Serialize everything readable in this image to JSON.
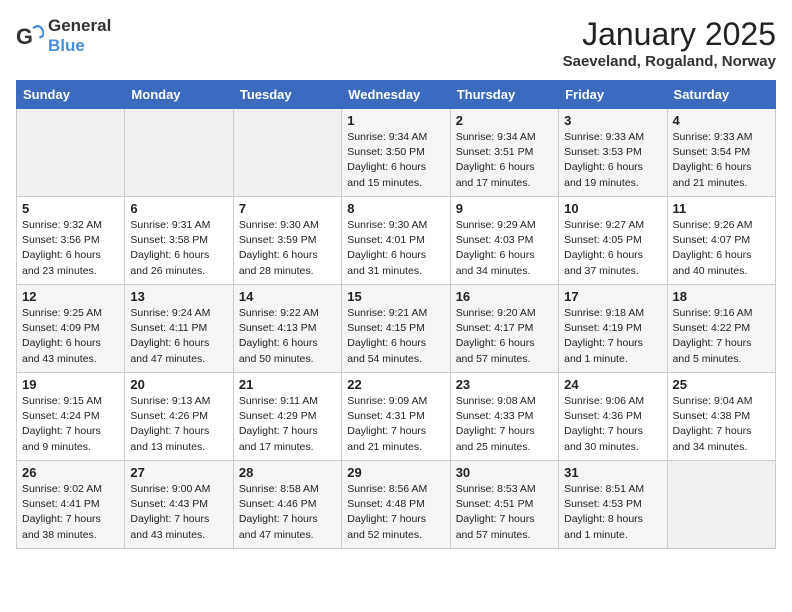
{
  "logo": {
    "general": "General",
    "blue": "Blue"
  },
  "title": "January 2025",
  "location": "Saeveland, Rogaland, Norway",
  "weekdays": [
    "Sunday",
    "Monday",
    "Tuesday",
    "Wednesday",
    "Thursday",
    "Friday",
    "Saturday"
  ],
  "weeks": [
    [
      {
        "day": "",
        "info": ""
      },
      {
        "day": "",
        "info": ""
      },
      {
        "day": "",
        "info": ""
      },
      {
        "day": "1",
        "info": "Sunrise: 9:34 AM\nSunset: 3:50 PM\nDaylight: 6 hours\nand 15 minutes."
      },
      {
        "day": "2",
        "info": "Sunrise: 9:34 AM\nSunset: 3:51 PM\nDaylight: 6 hours\nand 17 minutes."
      },
      {
        "day": "3",
        "info": "Sunrise: 9:33 AM\nSunset: 3:53 PM\nDaylight: 6 hours\nand 19 minutes."
      },
      {
        "day": "4",
        "info": "Sunrise: 9:33 AM\nSunset: 3:54 PM\nDaylight: 6 hours\nand 21 minutes."
      }
    ],
    [
      {
        "day": "5",
        "info": "Sunrise: 9:32 AM\nSunset: 3:56 PM\nDaylight: 6 hours\nand 23 minutes."
      },
      {
        "day": "6",
        "info": "Sunrise: 9:31 AM\nSunset: 3:58 PM\nDaylight: 6 hours\nand 26 minutes."
      },
      {
        "day": "7",
        "info": "Sunrise: 9:30 AM\nSunset: 3:59 PM\nDaylight: 6 hours\nand 28 minutes."
      },
      {
        "day": "8",
        "info": "Sunrise: 9:30 AM\nSunset: 4:01 PM\nDaylight: 6 hours\nand 31 minutes."
      },
      {
        "day": "9",
        "info": "Sunrise: 9:29 AM\nSunset: 4:03 PM\nDaylight: 6 hours\nand 34 minutes."
      },
      {
        "day": "10",
        "info": "Sunrise: 9:27 AM\nSunset: 4:05 PM\nDaylight: 6 hours\nand 37 minutes."
      },
      {
        "day": "11",
        "info": "Sunrise: 9:26 AM\nSunset: 4:07 PM\nDaylight: 6 hours\nand 40 minutes."
      }
    ],
    [
      {
        "day": "12",
        "info": "Sunrise: 9:25 AM\nSunset: 4:09 PM\nDaylight: 6 hours\nand 43 minutes."
      },
      {
        "day": "13",
        "info": "Sunrise: 9:24 AM\nSunset: 4:11 PM\nDaylight: 6 hours\nand 47 minutes."
      },
      {
        "day": "14",
        "info": "Sunrise: 9:22 AM\nSunset: 4:13 PM\nDaylight: 6 hours\nand 50 minutes."
      },
      {
        "day": "15",
        "info": "Sunrise: 9:21 AM\nSunset: 4:15 PM\nDaylight: 6 hours\nand 54 minutes."
      },
      {
        "day": "16",
        "info": "Sunrise: 9:20 AM\nSunset: 4:17 PM\nDaylight: 6 hours\nand 57 minutes."
      },
      {
        "day": "17",
        "info": "Sunrise: 9:18 AM\nSunset: 4:19 PM\nDaylight: 7 hours\nand 1 minute."
      },
      {
        "day": "18",
        "info": "Sunrise: 9:16 AM\nSunset: 4:22 PM\nDaylight: 7 hours\nand 5 minutes."
      }
    ],
    [
      {
        "day": "19",
        "info": "Sunrise: 9:15 AM\nSunset: 4:24 PM\nDaylight: 7 hours\nand 9 minutes."
      },
      {
        "day": "20",
        "info": "Sunrise: 9:13 AM\nSunset: 4:26 PM\nDaylight: 7 hours\nand 13 minutes."
      },
      {
        "day": "21",
        "info": "Sunrise: 9:11 AM\nSunset: 4:29 PM\nDaylight: 7 hours\nand 17 minutes."
      },
      {
        "day": "22",
        "info": "Sunrise: 9:09 AM\nSunset: 4:31 PM\nDaylight: 7 hours\nand 21 minutes."
      },
      {
        "day": "23",
        "info": "Sunrise: 9:08 AM\nSunset: 4:33 PM\nDaylight: 7 hours\nand 25 minutes."
      },
      {
        "day": "24",
        "info": "Sunrise: 9:06 AM\nSunset: 4:36 PM\nDaylight: 7 hours\nand 30 minutes."
      },
      {
        "day": "25",
        "info": "Sunrise: 9:04 AM\nSunset: 4:38 PM\nDaylight: 7 hours\nand 34 minutes."
      }
    ],
    [
      {
        "day": "26",
        "info": "Sunrise: 9:02 AM\nSunset: 4:41 PM\nDaylight: 7 hours\nand 38 minutes."
      },
      {
        "day": "27",
        "info": "Sunrise: 9:00 AM\nSunset: 4:43 PM\nDaylight: 7 hours\nand 43 minutes."
      },
      {
        "day": "28",
        "info": "Sunrise: 8:58 AM\nSunset: 4:46 PM\nDaylight: 7 hours\nand 47 minutes."
      },
      {
        "day": "29",
        "info": "Sunrise: 8:56 AM\nSunset: 4:48 PM\nDaylight: 7 hours\nand 52 minutes."
      },
      {
        "day": "30",
        "info": "Sunrise: 8:53 AM\nSunset: 4:51 PM\nDaylight: 7 hours\nand 57 minutes."
      },
      {
        "day": "31",
        "info": "Sunrise: 8:51 AM\nSunset: 4:53 PM\nDaylight: 8 hours\nand 1 minute."
      },
      {
        "day": "",
        "info": ""
      }
    ]
  ]
}
